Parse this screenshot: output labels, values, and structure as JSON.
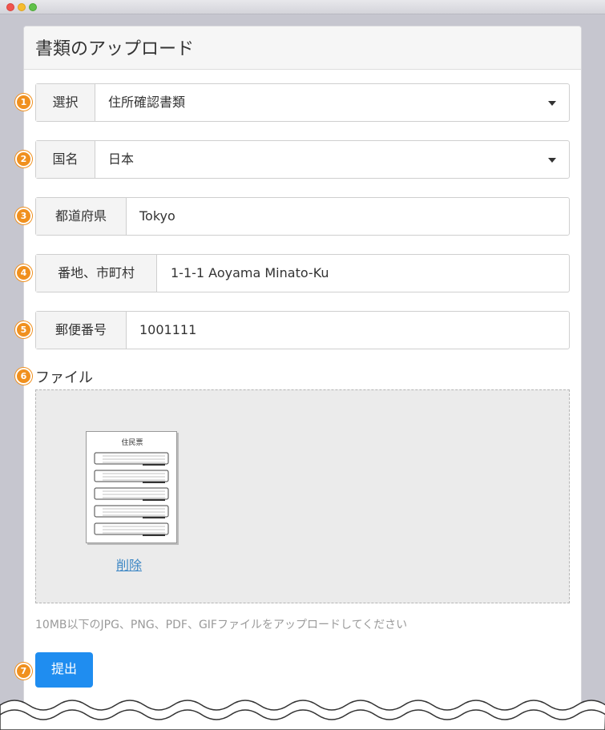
{
  "form": {
    "title": "書類のアップロード",
    "select_label": "選択",
    "select_value": "住所確認書類",
    "country_label": "国名",
    "country_value": "日本",
    "prefecture_label": "都道府県",
    "prefecture_value": "Tokyo",
    "address_label": "番地、市町村",
    "address_value": "1-1-1 Aoyama Minato-Ku",
    "postal_label": "郵便番号",
    "postal_value": "1001111",
    "file_label": "ファイル",
    "delete_label": "削除",
    "hint": "10MB以下のJPG、PNG、PDF、GIFファイルをアップロードしてください",
    "submit_label": "提出",
    "thumbnail_title": "住民票"
  },
  "badges": [
    "1",
    "2",
    "3",
    "4",
    "5",
    "6",
    "7"
  ],
  "colors": {
    "badge": "#f0901e",
    "primary_button": "#1f8df0",
    "link": "#3b86c4"
  },
  "icons": [
    "close-icon",
    "minimize-icon",
    "maximize-icon",
    "caret-down-icon",
    "document-thumbnail-icon"
  ]
}
